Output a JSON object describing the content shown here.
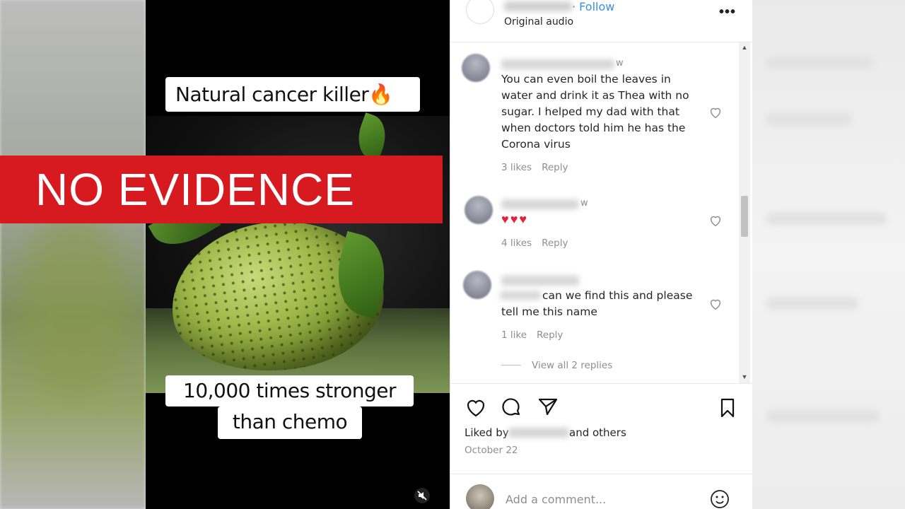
{
  "banner": {
    "text": "NO EVIDENCE",
    "color": "#d71920"
  },
  "video": {
    "caption_top": "Natural cancer killer",
    "caption_top_emoji": "🔥",
    "caption_bottom_line1": "10,000 times stronger",
    "caption_bottom_line2": "than chemo",
    "mute_icon": "speaker-muted-icon"
  },
  "post_header": {
    "follow_label": "· Follow",
    "audio_label": "Original audio",
    "more_icon": "•••"
  },
  "comments": [
    {
      "time": "w",
      "text": "You can even boil the leaves in water and drink it as Thea with no sugar. I helped my dad with that when doctors told him he has the Corona virus",
      "likes": "3 likes",
      "reply": "Reply"
    },
    {
      "time": "w",
      "text": "♥♥♥",
      "likes": "4 likes",
      "reply": "Reply"
    },
    {
      "time": "",
      "text_line1": "can we find this and please",
      "text_line2": "tell me this name",
      "likes": "1 like",
      "reply": "Reply",
      "view_replies": "View all 2 replies"
    }
  ],
  "actions": {
    "liked_prefix": "Liked by",
    "liked_suffix": "and others",
    "date": "October 22"
  },
  "add_comment": {
    "placeholder": "Add a comment..."
  }
}
